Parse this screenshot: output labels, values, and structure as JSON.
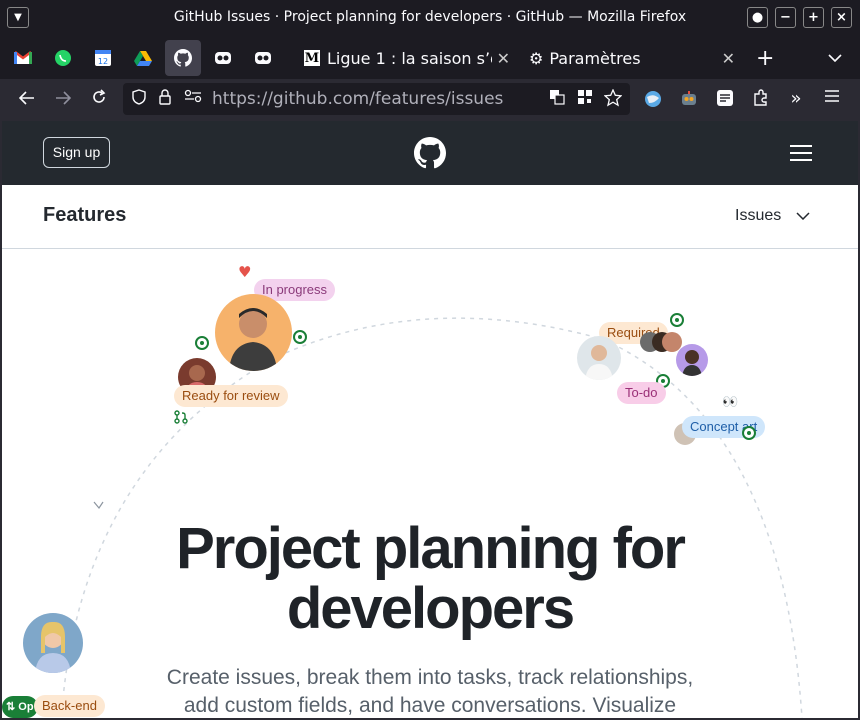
{
  "browser": {
    "window_title": "GitHub Issues · Project planning for developers · GitHub — Mozilla Firefox",
    "tabs": [
      {
        "label": "Ligue 1 : la saison s’o",
        "favicon": "M"
      },
      {
        "label": "Paramètres"
      }
    ],
    "new_tab": "+",
    "url_host": "https://github.com",
    "url_path": "/features/issues"
  },
  "github": {
    "signup_label": "Sign up",
    "subnav_title": "Features",
    "subnav_dropdown": "Issues"
  },
  "hero": {
    "title_line1": "Project planning for",
    "title_line2": "developers",
    "subtitle_line1": "Create issues, break them into tasks, track relationships,",
    "subtitle_line2": "add custom fields, and have conversations. Visualize"
  },
  "labels": {
    "in_progress": "In progress",
    "ready_for_review": "Ready for review",
    "required": "Required",
    "todo": "To-do",
    "concept_art": "Concept art",
    "back_end": "Back-end",
    "open_badge": "Op"
  },
  "colors": {
    "header_bg": "#24292f",
    "in_progress": "#f3d2ee",
    "ready_for_review": "#fde8d2",
    "todo": "#f8cde8",
    "concept_art": "#cfe6fb",
    "required": "#fde8d2",
    "open_green": "#1a7f37"
  }
}
